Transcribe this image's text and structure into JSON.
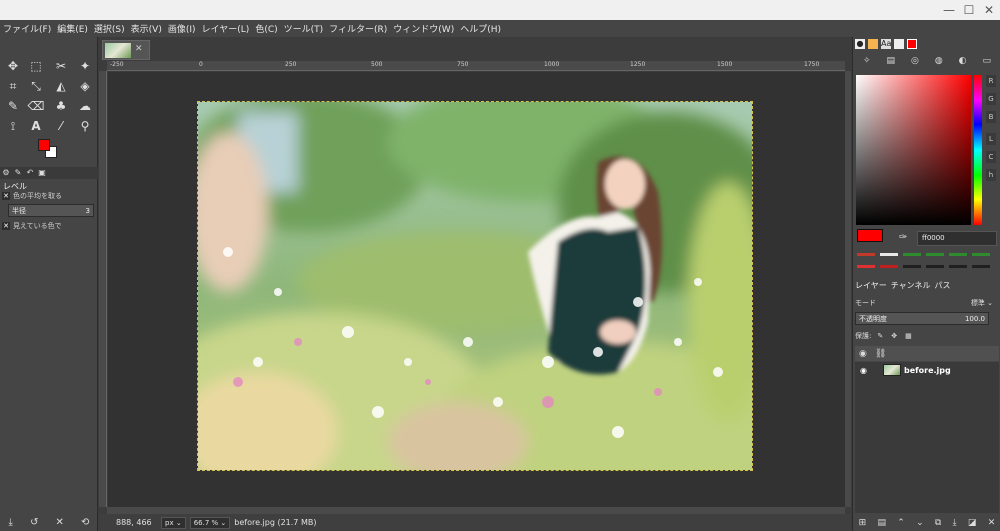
{
  "window": {
    "minimize": "—",
    "maximize": "☐",
    "close": "✕"
  },
  "menu": [
    "ファイル(F)",
    "編集(E)",
    "選択(S)",
    "表示(V)",
    "画像(I)",
    "レイヤー(L)",
    "色(C)",
    "ツール(T)",
    "フィルター(R)",
    "ウィンドウ(W)",
    "ヘルプ(H)"
  ],
  "toolbox": {
    "tools": [
      {
        "name": "move-tool-icon",
        "glyph": "✥"
      },
      {
        "name": "rect-select-icon",
        "glyph": "⬚"
      },
      {
        "name": "lasso-icon",
        "glyph": "✂"
      },
      {
        "name": "fuzzy-select-icon",
        "glyph": "✦"
      },
      {
        "name": "crop-icon",
        "glyph": "⌗"
      },
      {
        "name": "transform-icon",
        "glyph": "⤡"
      },
      {
        "name": "warp-icon",
        "glyph": "◭"
      },
      {
        "name": "bucket-fill-icon",
        "glyph": "◈"
      },
      {
        "name": "paintbrush-icon",
        "glyph": "✎"
      },
      {
        "name": "eraser-icon",
        "glyph": "⌫"
      },
      {
        "name": "clone-icon",
        "glyph": "♣"
      },
      {
        "name": "smudge-icon",
        "glyph": "☁"
      },
      {
        "name": "paths-icon",
        "glyph": "⟟"
      },
      {
        "name": "text-icon",
        "glyph": "A"
      },
      {
        "name": "color-picker-icon",
        "glyph": "⁄"
      },
      {
        "name": "zoom-icon",
        "glyph": "⚲"
      }
    ],
    "fg_color": "#ff0000",
    "bg_color": "#ffffff"
  },
  "tool_options": {
    "title": "レベル",
    "option1": "色の平均を取る",
    "radius_label": "半径",
    "radius_value": "3",
    "option2": "見えている色で"
  },
  "image_tab": {
    "close": "✕"
  },
  "rulers": {
    "h_labels": [
      "-250",
      "0",
      "250",
      "500",
      "750",
      "1000",
      "1250",
      "1500",
      "1750"
    ]
  },
  "status": {
    "coords": "888, 466",
    "unit": "px",
    "zoom": "66.7 %",
    "file": "before.jpg (21.7 MB)"
  },
  "colors_panel": {
    "components": [
      "R",
      "G",
      "B",
      "L",
      "C",
      "h"
    ],
    "hex": "ff0000",
    "history": [
      "#c0392b",
      "#e8e8e8",
      "#2e8b2e",
      "#2e8b2e",
      "#2e8b2e",
      "#2e8b2e",
      "#2e8b2e",
      "#e03030",
      "#c02020",
      "#202020",
      "#202020",
      "#202020"
    ]
  },
  "layers_panel": {
    "tabs": [
      "レイヤー",
      "チャンネル",
      "パス"
    ],
    "mode_label": "モード",
    "mode_value": "標準",
    "opacity_label": "不透明度",
    "opacity_value": "100.0",
    "lock_label": "保護:",
    "layer_name": "before.jpg"
  }
}
